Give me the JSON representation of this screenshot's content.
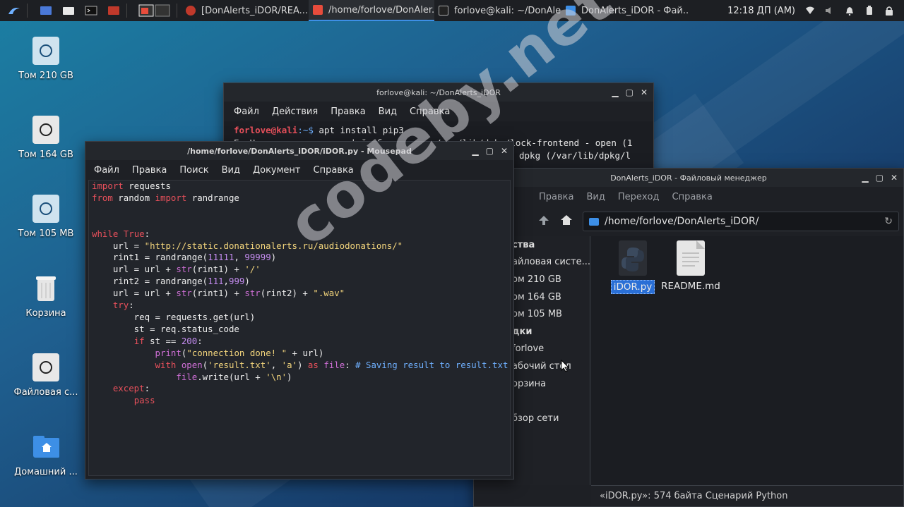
{
  "taskbar": {
    "tasks": [
      {
        "label": "[DonAlerts_iDOR/REA...",
        "color": "#c0392b"
      },
      {
        "label": "/home/forlove/DonAler...",
        "color": "#e74c3c"
      },
      {
        "label": "forlove@kali: ~/DonAle...",
        "color": "#666666"
      },
      {
        "label": "DonAlerts_iDOR - Фай...",
        "color": "#3d8fe6"
      }
    ],
    "clock": "12:18 ДП (AM)"
  },
  "desktop": {
    "icons": [
      {
        "label": "Том 210 GB"
      },
      {
        "label": "Том 164 GB"
      },
      {
        "label": "Том 105 MB"
      },
      {
        "label": "Корзина"
      },
      {
        "label": "Файловая с..."
      },
      {
        "label": "Домашний ..."
      }
    ]
  },
  "terminal": {
    "title": "forlove@kali: ~/DonAlerts_iDOR",
    "menu": [
      "Файл",
      "Действия",
      "Правка",
      "Вид",
      "Справка"
    ],
    "prompt_user": "forlove@kali",
    "prompt_path": ":~$",
    "command": " apt install pip3",
    "line2": "E: Не удалось открыть файл блокировки /var/lib/dpkg/lock-frontend - open (1",
    "line3": "dpkg (/var/lib/dpkg/l"
  },
  "mousepad": {
    "title": "/home/forlove/DonAlerts_iDOR/iDOR.py - Mousepad",
    "menu": [
      "Файл",
      "Правка",
      "Поиск",
      "Вид",
      "Документ",
      "Справка"
    ]
  },
  "file_manager": {
    "title": "DonAlerts_iDOR - Файловый менеджер",
    "menu": [
      "Правка",
      "Вид",
      "Переход",
      "Справка"
    ],
    "address": "/home/forlove/DonAlerts_iDOR/",
    "sidebar": [
      "ства",
      "айловая систе...",
      "ом 210 GB",
      "ом 164 GB",
      "ом 105 MB",
      "дки",
      "forlove",
      "абочий стол",
      "орзина",
      "",
      "бзор сети"
    ],
    "files": [
      {
        "name": "iDOR.py",
        "selected": true
      },
      {
        "name": "README.md",
        "selected": false
      }
    ],
    "status": "«iDOR.py»: 574 байта Сценарий Python"
  },
  "watermark": "codeby.net"
}
